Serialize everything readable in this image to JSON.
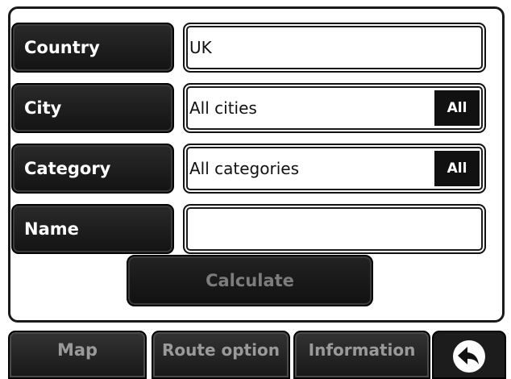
{
  "form": {
    "country": {
      "label": "Country",
      "value": "UK"
    },
    "city": {
      "label": "City",
      "value": "All cities",
      "all_button": "All"
    },
    "category": {
      "label": "Category",
      "value": "All categories",
      "all_button": "All"
    },
    "name": {
      "label": "Name",
      "value": ""
    },
    "calculate_label": "Calculate"
  },
  "tabs": {
    "map": "Map",
    "route_option": "Route option",
    "information": "Information",
    "back_icon": "back-arrow-icon"
  }
}
